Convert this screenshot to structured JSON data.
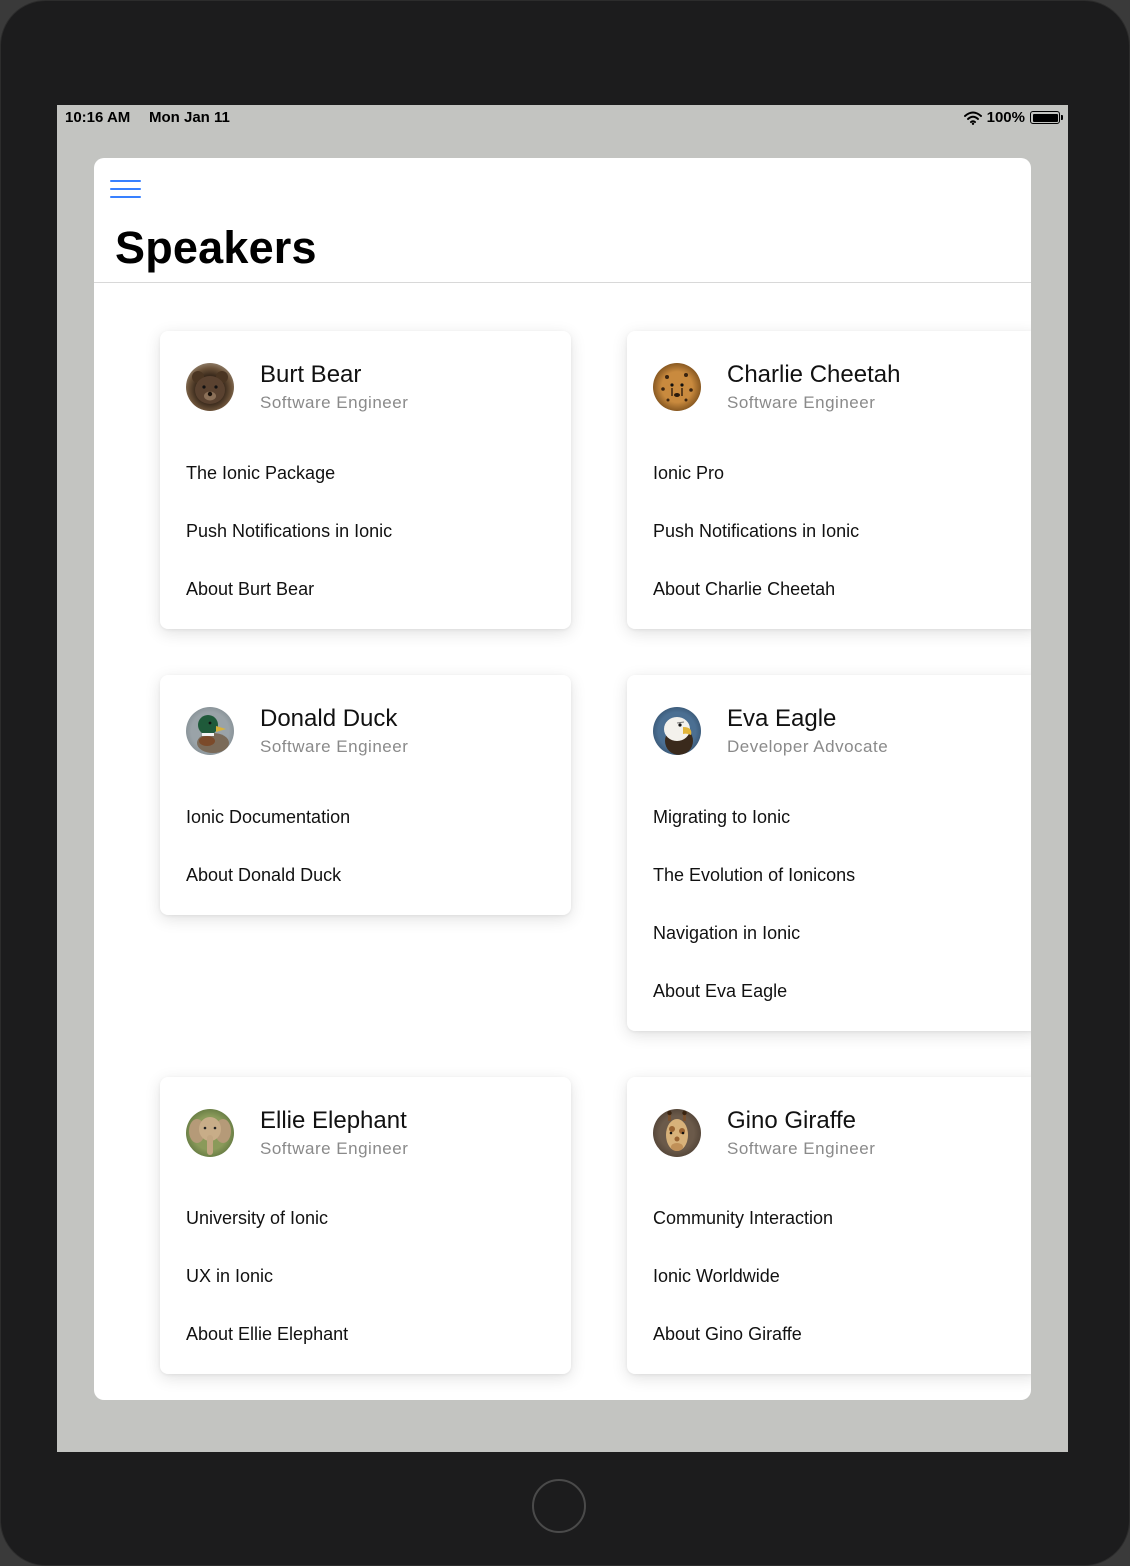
{
  "status_bar": {
    "time": "10:16 AM",
    "date": "Mon Jan 11",
    "battery": "100%"
  },
  "page": {
    "title": "Speakers"
  },
  "speakers": [
    {
      "name": "Burt Bear",
      "role": "Software Engineer",
      "avatar": "bear-photo",
      "talks": [
        "The Ionic Package",
        "Push Notifications in Ionic"
      ],
      "about": "About Burt Bear"
    },
    {
      "name": "Charlie Cheetah",
      "role": "Software Engineer",
      "avatar": "cheetah-photo",
      "talks": [
        "Ionic Pro",
        "Push Notifications in Ionic"
      ],
      "about": "About Charlie Cheetah"
    },
    {
      "name": "Donald Duck",
      "role": "Software Engineer",
      "avatar": "duck-photo",
      "talks": [
        "Ionic Documentation"
      ],
      "about": "About Donald Duck"
    },
    {
      "name": "Eva Eagle",
      "role": "Developer Advocate",
      "avatar": "eagle-photo",
      "talks": [
        "Migrating to Ionic",
        "The Evolution of Ionicons",
        "Navigation in Ionic"
      ],
      "about": "About Eva Eagle"
    },
    {
      "name": "Ellie Elephant",
      "role": "Software Engineer",
      "avatar": "elephant-photo",
      "talks": [
        "University of Ionic",
        "UX in Ionic"
      ],
      "about": "About Ellie Elephant"
    },
    {
      "name": "Gino Giraffe",
      "role": "Software Engineer",
      "avatar": "giraffe-photo",
      "talks": [
        "Community Interaction",
        "Ionic Worldwide"
      ],
      "about": "About Gino Giraffe"
    }
  ],
  "colors": {
    "accent": "#3880ff",
    "screen_background": "#c3c4c1",
    "device_frame": "#1c1c1d"
  }
}
